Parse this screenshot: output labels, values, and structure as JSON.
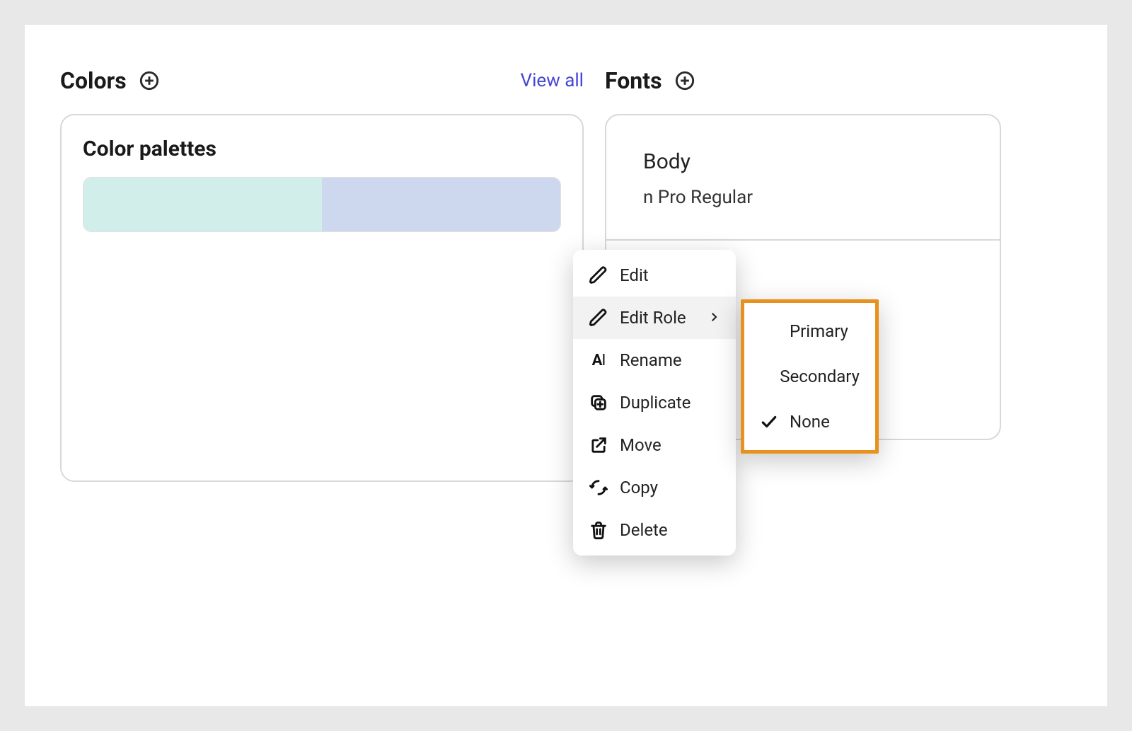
{
  "colors": {
    "title": "Colors",
    "view_all": "View all",
    "card_title": "Color palettes",
    "swatches": [
      "#d1eeea",
      "#cdd8ee"
    ]
  },
  "fonts": {
    "title": "Fonts",
    "role_label": "Body",
    "font_name": "n Pro Regular"
  },
  "context_menu": {
    "edit": "Edit",
    "edit_role": "Edit Role",
    "rename": "Rename",
    "duplicate": "Duplicate",
    "move": "Move",
    "copy": "Copy",
    "delete": "Delete"
  },
  "submenu": {
    "primary": "Primary",
    "secondary": "Secondary",
    "none": "None",
    "selected": "none"
  },
  "accent_highlight": "#e8911e",
  "link_color": "#4646d6"
}
